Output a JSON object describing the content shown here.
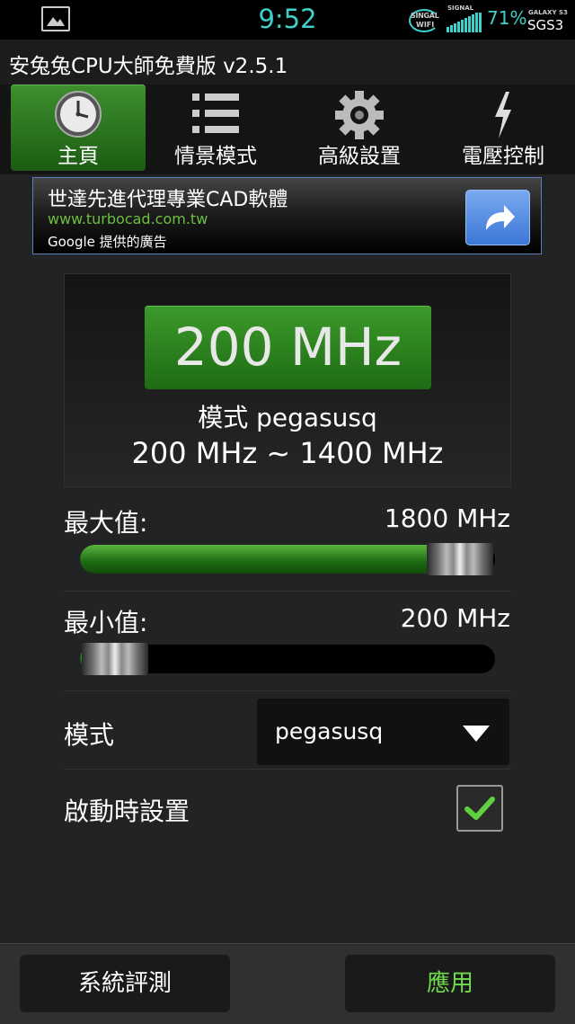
{
  "status_bar": {
    "time": "9:52",
    "singal_top": "SINGAL",
    "singal_bottom": "WIFI",
    "signal_label": "SIGNAL",
    "battery": "71%",
    "galaxy": "GALAXY S3",
    "model": "SGS3",
    "accent_color": "#3fd1c9"
  },
  "app": {
    "title": "安兔兔CPU大師免費版 v2.5.1"
  },
  "tabs": [
    {
      "label": "主頁",
      "icon": "clock-icon",
      "active": true
    },
    {
      "label": "情景模式",
      "icon": "list-icon",
      "active": false
    },
    {
      "label": "高級設置",
      "icon": "gear-icon",
      "active": false
    },
    {
      "label": "電壓控制",
      "icon": "lightning-icon",
      "active": false
    }
  ],
  "ad": {
    "headline": "世達先進代理專業CAD軟體",
    "url": "www.turbocad.com.tw",
    "attribution": "Google 提供的廣告"
  },
  "cpu": {
    "current_freq": "200 MHz",
    "mode_line": "模式 pegasusq",
    "range_line": "200 MHz ~ 1400 MHz"
  },
  "max_slider": {
    "label": "最大值:",
    "value": "1800 MHz",
    "fraction": 1.0
  },
  "min_slider": {
    "label": "最小值:",
    "value": "200 MHz",
    "fraction": 0.0
  },
  "governor": {
    "label": "模式",
    "selected": "pegasusq"
  },
  "set_on_boot": {
    "label": "啟動時設置",
    "checked": true
  },
  "buttons": {
    "benchmark": "系統評測",
    "apply": "應用"
  },
  "colors": {
    "green": "#2e8a1f",
    "apply_text": "#6fdc4f",
    "check": "#5fd03f"
  }
}
